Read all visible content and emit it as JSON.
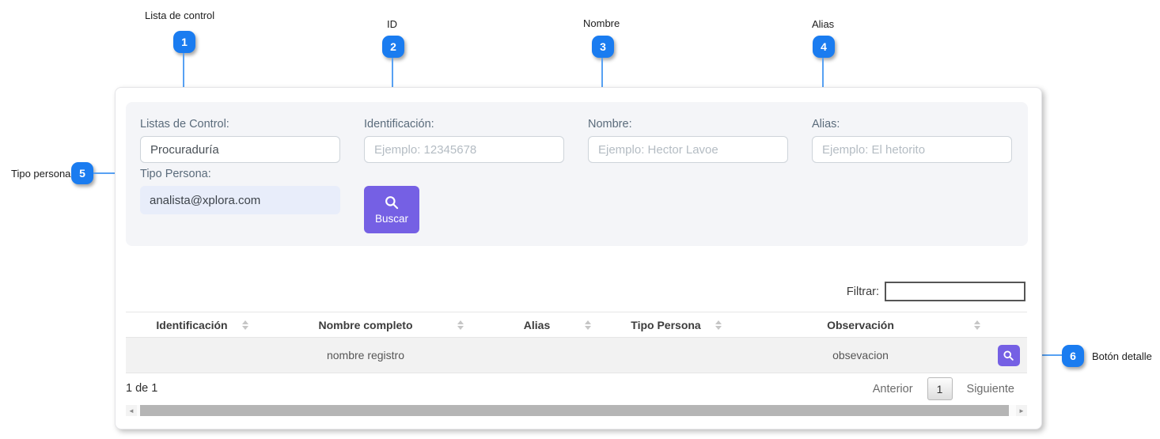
{
  "callouts": [
    {
      "num": "1",
      "label": "Lista de control"
    },
    {
      "num": "2",
      "label": "ID"
    },
    {
      "num": "3",
      "label": "Nombre"
    },
    {
      "num": "4",
      "label": "Alias"
    },
    {
      "num": "5",
      "label": "Tipo persona"
    },
    {
      "num": "6",
      "label": "Botón detalle"
    }
  ],
  "form": {
    "lista_control": {
      "label": "Listas de Control:",
      "value": "Procuraduría"
    },
    "identificacion": {
      "label": "Identificación:",
      "placeholder": "Ejemplo: 12345678"
    },
    "nombre": {
      "label": "Nombre:",
      "placeholder": "Ejemplo: Hector Lavoe"
    },
    "alias": {
      "label": "Alias:",
      "placeholder": "Ejemplo: El hetorito"
    },
    "tipo_persona": {
      "label": "Tipo Persona:",
      "value": "analista@xplora.com"
    },
    "buscar_label": "Buscar"
  },
  "filter": {
    "label": "Filtrar:"
  },
  "table": {
    "headers": [
      "Identificación",
      "Nombre completo",
      "Alias",
      "Tipo Persona",
      "Observación"
    ],
    "row": {
      "identificacion": "",
      "nombre_completo": "nombre registro",
      "alias": "",
      "tipo_persona": "",
      "observacion": "obsevacion"
    }
  },
  "pagination": {
    "info": "1 de 1",
    "prev": "Anterior",
    "page": "1",
    "next": "Siguiente"
  },
  "scrollbar": {
    "left_arrow": "◄",
    "right_arrow": "►"
  },
  "colors": {
    "accent_purple": "#7560e4",
    "callout_blue": "#1a7cf0",
    "callout_line": "#57a1f3"
  }
}
